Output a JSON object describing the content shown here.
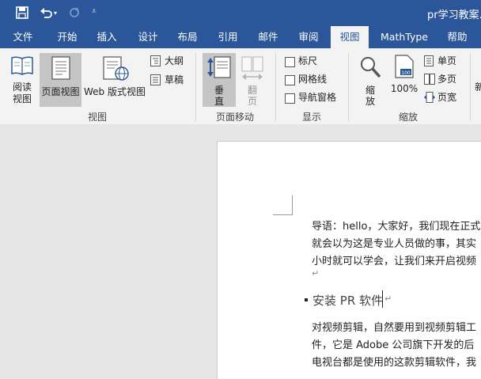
{
  "titlebar": {
    "title": "pr学习教案..."
  },
  "tabs": [
    "文件",
    "开始",
    "插入",
    "设计",
    "布局",
    "引用",
    "邮件",
    "审阅",
    "视图",
    "MathType",
    "帮助"
  ],
  "active_tab": "视图",
  "ribbon": {
    "views": {
      "read_mode": [
        "阅读",
        "视图"
      ],
      "print_layout": "页面视图",
      "web_layout": "Web 版式视图",
      "outline": "大纲",
      "draft": "草稿",
      "group_label": "视图"
    },
    "page_movement": {
      "vertical": [
        "垂",
        "直"
      ],
      "side_by_side": [
        "翻",
        "页"
      ],
      "group_label": "页面移动"
    },
    "show": {
      "ruler": "标尺",
      "gridlines": "网格线",
      "nav_pane": "导航窗格",
      "group_label": "显示"
    },
    "zoom": {
      "zoom": [
        "缩",
        "放"
      ],
      "hundred": "100%",
      "one_page": "单页",
      "multi_page": "多页",
      "page_width": "页宽",
      "group_label": "缩放"
    },
    "new_window_partial": "新"
  },
  "document": {
    "para1_line1": "导语：hello，大家好，我们现在正式",
    "para1_line2": "就会以为这是专业人员做的事，其实",
    "para1_line3": "小时就可以学会，让我们来开启视频",
    "heading": "安装 PR 软件",
    "para2_line1": "对视频剪辑，自然要用到视频剪辑工",
    "para2_line2": "件，它是 Adobe 公司旗下开发的后",
    "para2_line3": "电视台都是使用的这款剪辑软件，我"
  },
  "colors": {
    "accent": "#2b579a",
    "ribbon_bg": "#f3f3f3",
    "workspace_bg": "#e6e6e6"
  }
}
